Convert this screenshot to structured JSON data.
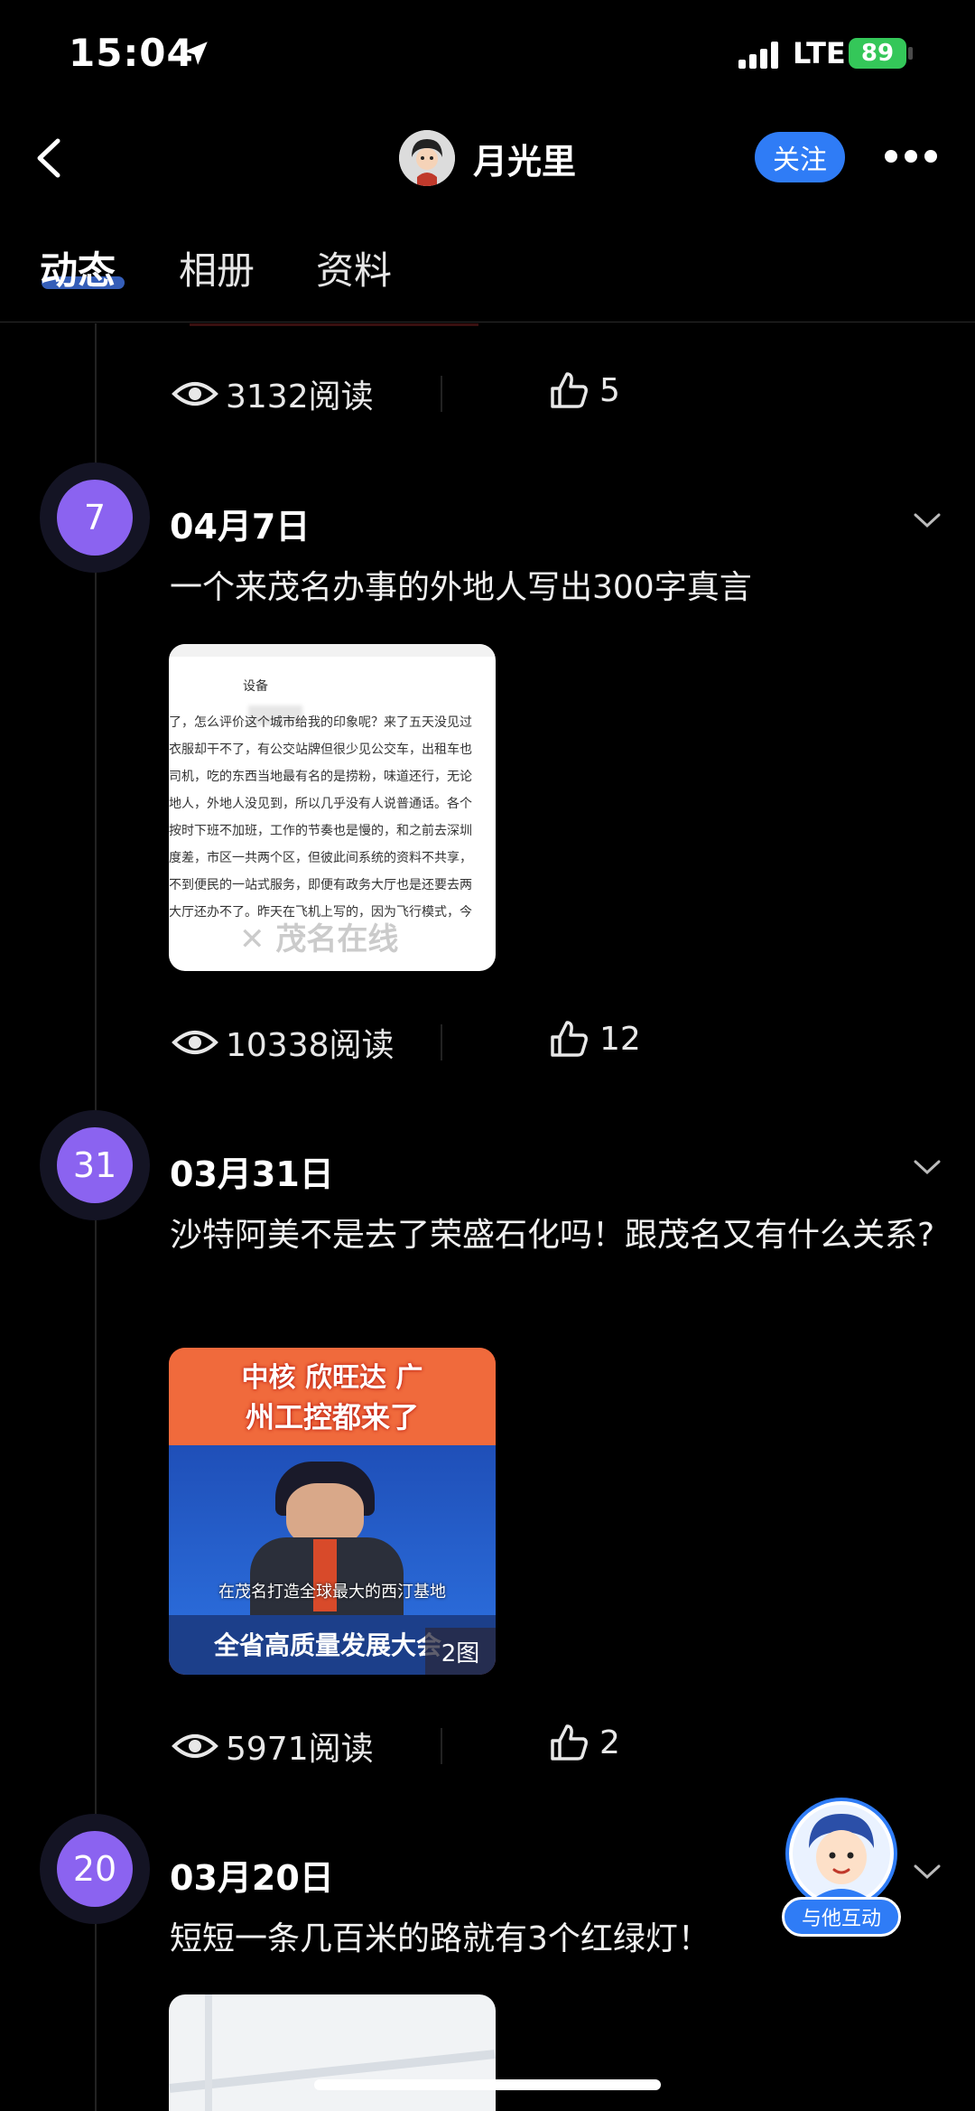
{
  "status_bar": {
    "time": "15:04",
    "network": "LTE",
    "battery": "89"
  },
  "header": {
    "username": "月光里",
    "follow_label": "关注"
  },
  "tabs": [
    {
      "label": "动态"
    },
    {
      "label": "相册"
    },
    {
      "label": "资料"
    }
  ],
  "top_stats": {
    "reads": "3132阅读",
    "likes": "5"
  },
  "posts": [
    {
      "day": "7",
      "date": "04月7日",
      "text": "一个来茂名办事的外地人写出300字真言",
      "reads": "10338阅读",
      "likes": "12",
      "doc_lines": [
        "设备",
        "了，怎么评价这个城市给我的印象呢？来了五天没见过",
        "衣服却干不了，有公交站牌但很少见公交车，出租车也",
        "司机，吃的东西当地最有名的是捞粉，味道还行，无论",
        "地人，外地人没见到，所以几乎没有人说普通话。各个",
        "按时下班不加班，工作的节奏也是慢的，和之前去深圳",
        "度差，市区一共两个区，但彼此间系统的资料不共享，",
        "不到便民的一站式服务，即便有政务大厅也是还要去两",
        "大厅还办不了。昨天在飞机上写的，因为飞行模式，今"
      ]
    },
    {
      "day": "31",
      "date": "03月31日",
      "text": "沙特阿美不是去了荣盛石化吗！跟茂名又有什么关系?",
      "reads": "5971阅读",
      "likes": "2",
      "image_top_line1": "中核 欣旺达 广",
      "image_top_line2": "州工控都来了",
      "image_caption": "在茂名打造全球最大的西汀基地",
      "image_banner": "全省高质量发展大会",
      "image_count": "2图"
    },
    {
      "day": "20",
      "date": "03月20日",
      "text": "短短一条几百米的路就有3个红绿灯！"
    }
  ],
  "float_button": {
    "label": "与他互动"
  },
  "colors": {
    "accent": "#2f7cf6",
    "timeline_dot": "#8b63f0",
    "battery": "#34c759"
  }
}
